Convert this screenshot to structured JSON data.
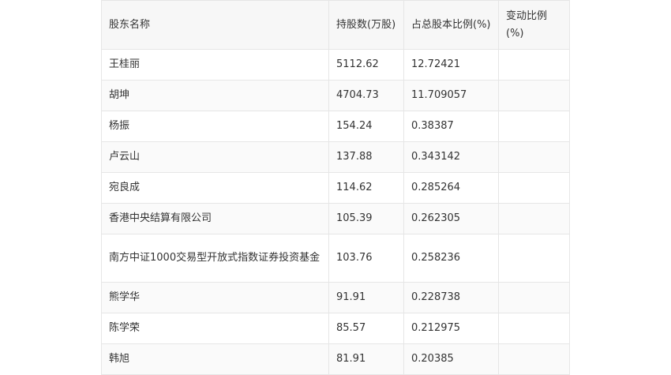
{
  "table": {
    "headers": [
      "股东名称",
      "持股数(万股)",
      "占总股本比例(%)",
      "变动比例(%)"
    ],
    "rows": [
      {
        "name": "王桂丽",
        "shares": "5112.62",
        "ratio": "12.72421",
        "change": ""
      },
      {
        "name": "胡坤",
        "shares": "4704.73",
        "ratio": "11.709057",
        "change": ""
      },
      {
        "name": "杨振",
        "shares": "154.24",
        "ratio": "0.38387",
        "change": ""
      },
      {
        "name": "卢云山",
        "shares": "137.88",
        "ratio": "0.343142",
        "change": ""
      },
      {
        "name": "宛良成",
        "shares": "114.62",
        "ratio": "0.285264",
        "change": ""
      },
      {
        "name": "香港中央结算有限公司",
        "shares": "105.39",
        "ratio": "0.262305",
        "change": ""
      },
      {
        "name": "南方中证1000交易型开放式指数证券投资基金",
        "shares": "103.76",
        "ratio": "0.258236",
        "change": ""
      },
      {
        "name": "熊学华",
        "shares": "91.91",
        "ratio": "0.228738",
        "change": ""
      },
      {
        "name": "陈学荣",
        "shares": "85.57",
        "ratio": "0.212975",
        "change": ""
      },
      {
        "name": "韩旭",
        "shares": "81.91",
        "ratio": "0.20385",
        "change": ""
      }
    ]
  }
}
